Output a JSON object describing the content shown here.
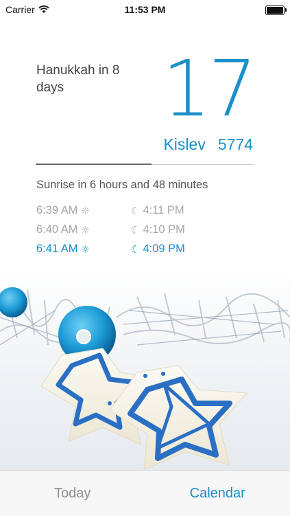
{
  "status_bar": {
    "carrier": "Carrier",
    "time": "11:53 PM"
  },
  "countdown_text": "Hanukkah in 8 days",
  "day_number": "17",
  "hebrew_month": "Kislev",
  "hebrew_year": "5774",
  "month_progress": 0.53,
  "sunrise_text": "Sunrise in 6 hours and 48 minutes",
  "times": [
    {
      "sunrise": "6:39 AM",
      "sunset": "4:11 PM",
      "current": false
    },
    {
      "sunrise": "6:40 AM",
      "sunset": "4:10 PM",
      "current": false
    },
    {
      "sunrise": "6:41 AM",
      "sunset": "4:09 PM",
      "current": true
    }
  ],
  "icons": {
    "sunrise": "sun-icon",
    "sunset": "moon-icon"
  },
  "colors": {
    "accent": "#1a8fc9",
    "muted": "#a6a6a6"
  },
  "tabs": [
    {
      "label": "Today",
      "active": false
    },
    {
      "label": "Calendar",
      "active": true
    }
  ]
}
